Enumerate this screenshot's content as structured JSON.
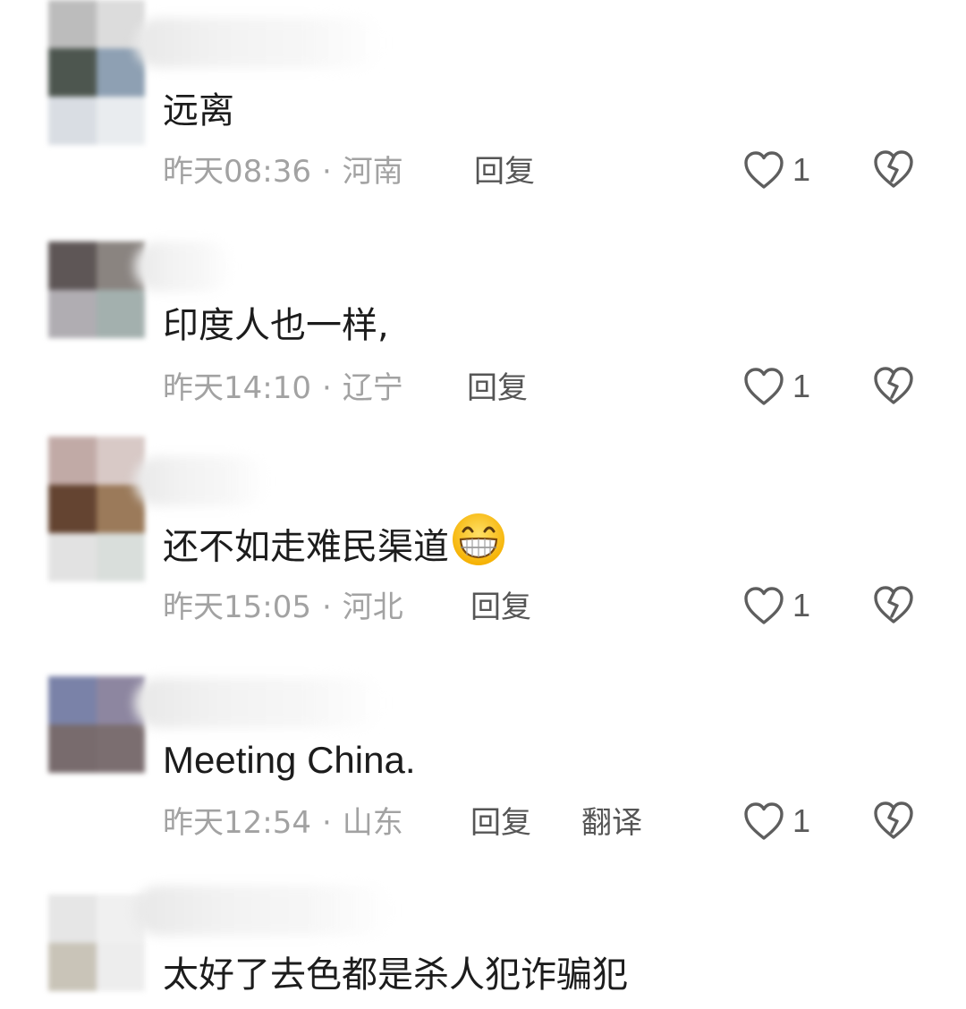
{
  "comments": [
    {
      "avatar_colors": [
        "#bcbcbc",
        "#dcdcdc",
        "#4d564f",
        "#8ea0b3",
        "#d9dde3",
        "#e9ecef"
      ],
      "text": "远离",
      "time": "昨天08:36",
      "location": "河南",
      "reply_label": "回复",
      "likes": "1"
    },
    {
      "avatar_colors": [
        "#5e5656",
        "#8a8480",
        "#b0adb2",
        "#a3b0ae"
      ],
      "text": "印度人也一样,",
      "time": "昨天14:10",
      "location": "辽宁",
      "reply_label": "回复",
      "likes": "1"
    },
    {
      "avatar_colors": [
        "#c1aaa6",
        "#d8c9c6",
        "#644431",
        "#9b7a5a",
        "#e2e2e2",
        "#d9dedb"
      ],
      "text": "还不如走难民渠道",
      "emoji": "grinning-face-emoji",
      "time": "昨天15:05",
      "location": "河北",
      "reply_label": "回复",
      "likes": "1"
    },
    {
      "avatar_colors": [
        "#7a82a8",
        "#8d86a0",
        "#786b6d",
        "#7b6e70"
      ],
      "text": "Meeting China.",
      "time": "昨天12:54",
      "location": "山东",
      "reply_label": "回复",
      "translate_label": "翻译",
      "likes": "1"
    },
    {
      "avatar_colors": [
        "#e6e6e6",
        "#f0f0f0",
        "#c9c4b8",
        "#ededed"
      ],
      "text": "太好了去色都是杀人犯诈骗犯"
    }
  ],
  "separator": "·",
  "icons": {
    "like": "heart-outline-icon",
    "dislike": "broken-heart-icon"
  }
}
